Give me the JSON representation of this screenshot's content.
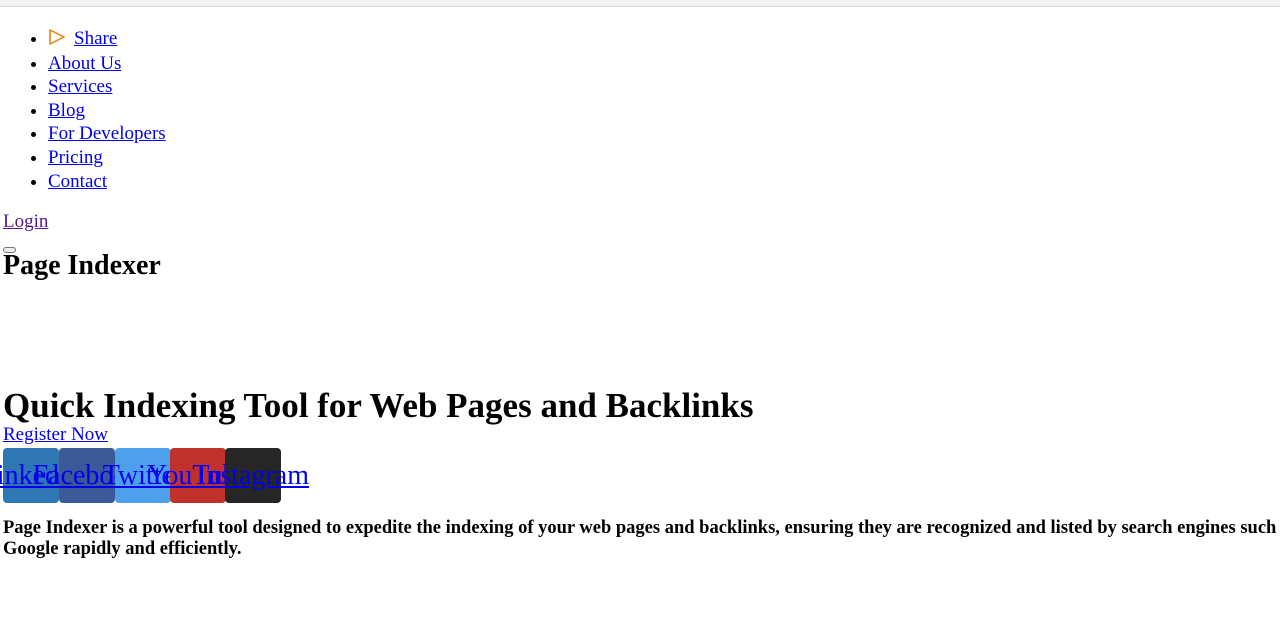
{
  "nav": {
    "items": [
      {
        "label": "Share"
      },
      {
        "label": "About Us"
      },
      {
        "label": "Services"
      },
      {
        "label": "Blog"
      },
      {
        "label": "For Developers"
      },
      {
        "label": "Pricing"
      },
      {
        "label": "Contact"
      }
    ],
    "share_icon": "play-outline-icon",
    "share_icon_color": "#e8912d"
  },
  "login_label": "Login",
  "brand": "Page Indexer",
  "hero_title": "Quick Indexing Tool for Web Pages and Backlinks",
  "register_label": "Register Now",
  "social": [
    {
      "label": "LinkedIn",
      "color": "#2f77b4"
    },
    {
      "label": "Facebook",
      "color": "#3b5998"
    },
    {
      "label": "Twitter",
      "color": "#4da1ec"
    },
    {
      "label": "YouTube",
      "color": "#c0312b"
    },
    {
      "label": "Instagram",
      "color": "#262626"
    }
  ],
  "description": "Page Indexer is a powerful tool designed to expedite the indexing of your web pages and backlinks, ensuring they are recognized and listed by search engines such as Google rapidly and efficiently."
}
